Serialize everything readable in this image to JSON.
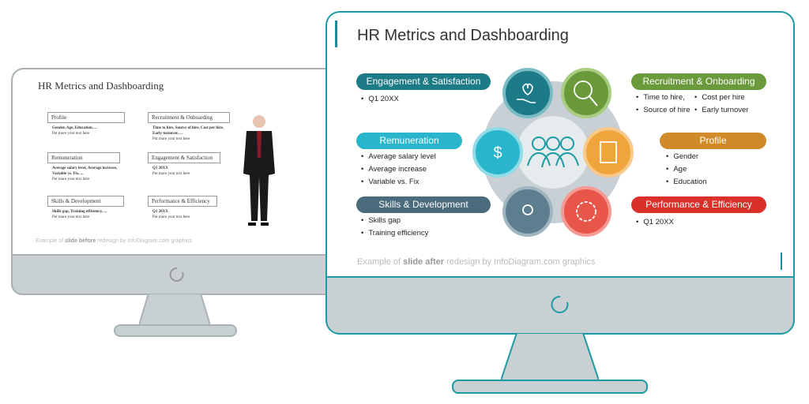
{
  "before_slide": {
    "title": "HR Metrics and Dashboarding",
    "sections": [
      {
        "label": "Profile",
        "bold": "Gender, Age, Education, ...",
        "note": "Put more your text here"
      },
      {
        "label": "Recruitment & Onboarding",
        "bold": "Time to hire, Source of hire, Cost per hire, Early turnover, ...",
        "note": "Put more your text here"
      },
      {
        "label": "Remuneration",
        "bold": "Average salary level, Average increase, Variable vs. Fix, ...",
        "note": "Put more your text here"
      },
      {
        "label": "Engagement & Satisfaction",
        "bold": "Q1 20XX",
        "note": "Put more your text here"
      },
      {
        "label": "Skills & Development",
        "bold": "Skills gap, Training efficiency, ...",
        "note": "Put more your text here"
      },
      {
        "label": "Performance & Efficiency",
        "bold": "Q1 20XX",
        "note": "Put more your text here"
      }
    ],
    "footer_pre": "Example of ",
    "footer_bold": "slide before",
    "footer_post": " redesign by InfoDiagram.com graphics"
  },
  "after_slide": {
    "title": "HR Metrics and Dashboarding",
    "categories": [
      {
        "label": "Engagement & Satisfaction",
        "color": "#1d7b88",
        "items": [
          "Q1 20XX"
        ],
        "icon": "heart-hand-icon"
      },
      {
        "label": "Remuneration",
        "color": "#29b5cc",
        "items": [
          "Average salary level",
          "Average increase",
          "Variable vs. Fix"
        ],
        "icon": "money-bag-icon"
      },
      {
        "label": "Skills & Development",
        "color": "#4a6b7c",
        "items": [
          "Skills gap",
          "Training efficiency"
        ],
        "icon": "head-gear-icon"
      },
      {
        "label": "Recruitment & Onboarding",
        "color": "#6a9a3c",
        "items": [
          "Time to hire,",
          "Cost per hire",
          "Source of hire",
          "Early turnover"
        ],
        "icon": "search-person-icon"
      },
      {
        "label": "Profile",
        "color": "#d08a2a",
        "items": [
          "Gender",
          "Age",
          "Education"
        ],
        "icon": "profile-document-icon"
      },
      {
        "label": "Performance & Efficiency",
        "color": "#d9302a",
        "items": [
          "Q1 20XX"
        ],
        "icon": "gear-person-icon"
      }
    ],
    "center_icon": "people-group-icon",
    "footer_pre": "Example of ",
    "footer_bold": "slide after",
    "footer_post": " redesign by InfoDiagram.com graphics"
  }
}
